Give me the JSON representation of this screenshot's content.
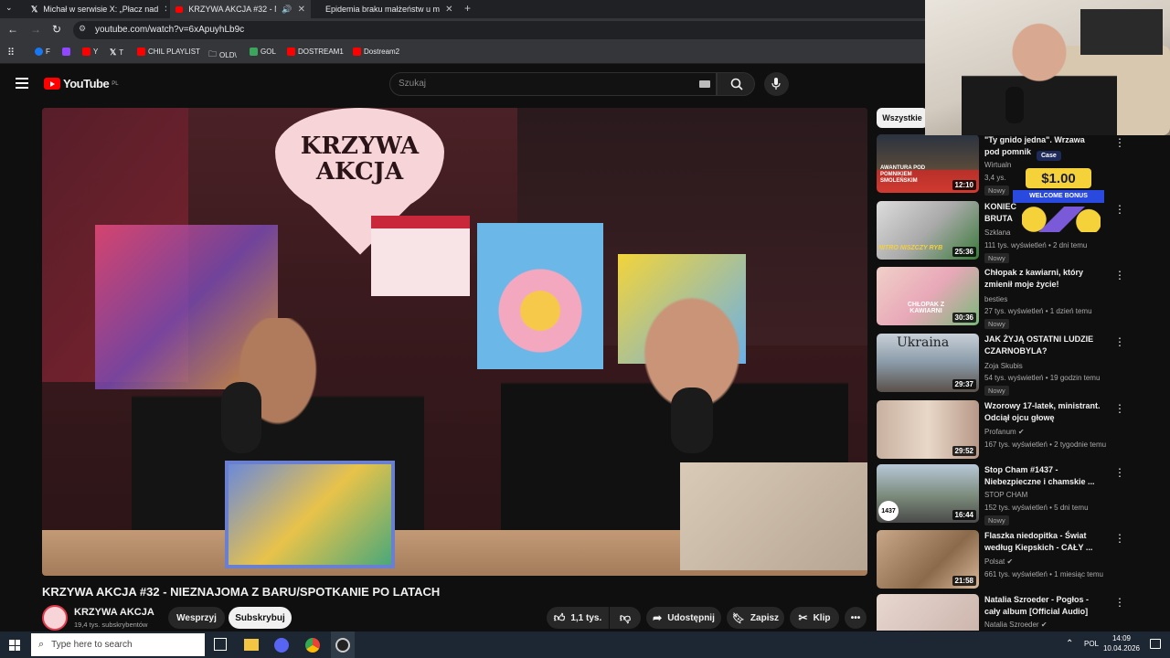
{
  "browser": {
    "tabs": [
      {
        "title": "Michał w serwisie X: „Płacz nad",
        "icon": "x-icon"
      },
      {
        "title": "KRZYWA AKCJA #32 - NIEZNAJOM",
        "icon": "youtube-icon",
        "active": true
      },
      {
        "title": "Epidemia braku małżeństw u m",
        "icon": "youtube-icon"
      }
    ],
    "url": "youtube.com/watch?v=6xApuyhLb9c",
    "bookmarks": [
      "F",
      "Y",
      "T",
      "CHIL PLAYLIST",
      "OLD\\",
      "GOL",
      "DOSTREAM1",
      "Dostream2"
    ]
  },
  "youtube": {
    "logo": "YouTube",
    "region": "PL",
    "search_placeholder": "Szukaj"
  },
  "video": {
    "sign_line1": "KRZYWA",
    "sign_line2": "AKCJA",
    "title": "KRZYWA AKCJA #32 - NIEZNAJOMA Z BARU/SPOTKANIE PO LATACH",
    "channel": "KRZYWA AKCJA",
    "subscribers": "19,4 tys. subskrybentów",
    "support_label": "Wesprzyj",
    "subscribe_label": "Subskrybuj",
    "likes": "1,1 tys.",
    "share_label": "Udostępnij",
    "save_label": "Zapisz",
    "clip_label": "Klip"
  },
  "filter_chip": "Wszystkie",
  "recommendations": [
    {
      "title": "\"Ty gnido jedna\". Wrzawa pod pomnik",
      "channel": "Wirtualn",
      "meta": "3,4 ys.",
      "badge": "Nowy",
      "duration": "12:10",
      "thumb_text": "AWANTURA POD POMNIKIEM SMOLEŃSKIM"
    },
    {
      "title": "KONIEC BRUTA",
      "channel": "Szklana",
      "meta": "111 tys. wyświetleń • 2 dni temu",
      "badge": "Nowy",
      "duration": "25:36",
      "thumb_text": "NITRO NISZCZY RYB"
    },
    {
      "title": "Chłopak z kawiarni, który zmienił moje życie!",
      "channel": "besties",
      "meta": "27 tys. wyświetleń • 1 dzień temu",
      "badge": "Nowy",
      "duration": "30:36",
      "thumb_text": "CHŁOPAK Z KAWIARNI"
    },
    {
      "title": "JAK ŻYJĄ OSTATNI LUDZIE CZARNOBYLA?",
      "channel": "Zoja Skubis",
      "meta": "54 tys. wyświetleń • 19 godzin temu",
      "badge": "Nowy",
      "duration": "29:37",
      "thumb_text": "Ukraina"
    },
    {
      "title": "Wzorowy 17-latek, ministrant. Odciął ojcu głowę",
      "channel": "Profanum",
      "meta": "167 tys. wyświetleń • 2 tygodnie temu",
      "badge": "",
      "duration": "29:52",
      "thumb_text": ""
    },
    {
      "title": "Stop Cham #1437 - Niebezpieczne i chamskie ...",
      "channel": "STOP CHAM",
      "meta": "152 tys. wyświetleń • 5 dni temu",
      "badge": "Nowy",
      "duration": "16:44",
      "thumb_text": "1437"
    },
    {
      "title": "Flaszka niedopitka - Świat według Kiepskich - CAŁY ...",
      "channel": "Polsat",
      "meta": "661 tys. wyświetleń • 1 miesiąc temu",
      "badge": "",
      "duration": "21:58",
      "thumb_text": ""
    },
    {
      "title": "Natalia Szroeder - Pogłos - cały album [Official Audio]",
      "channel": "Natalia Szroeder",
      "meta": "",
      "badge": "",
      "duration": "",
      "thumb_text": ""
    }
  ],
  "ad_overlay": {
    "brand": "Case",
    "amount": "$1.00",
    "label": "WELCOME BONUS"
  },
  "taskbar": {
    "search_placeholder": "Type here to search",
    "lang": "POL",
    "time": "14:09",
    "date": "10.04.2026"
  },
  "colors": {
    "youtube_red": "#ff0000",
    "background": "#0f0f0f",
    "subscribe_bg": "#f1f1f1"
  }
}
